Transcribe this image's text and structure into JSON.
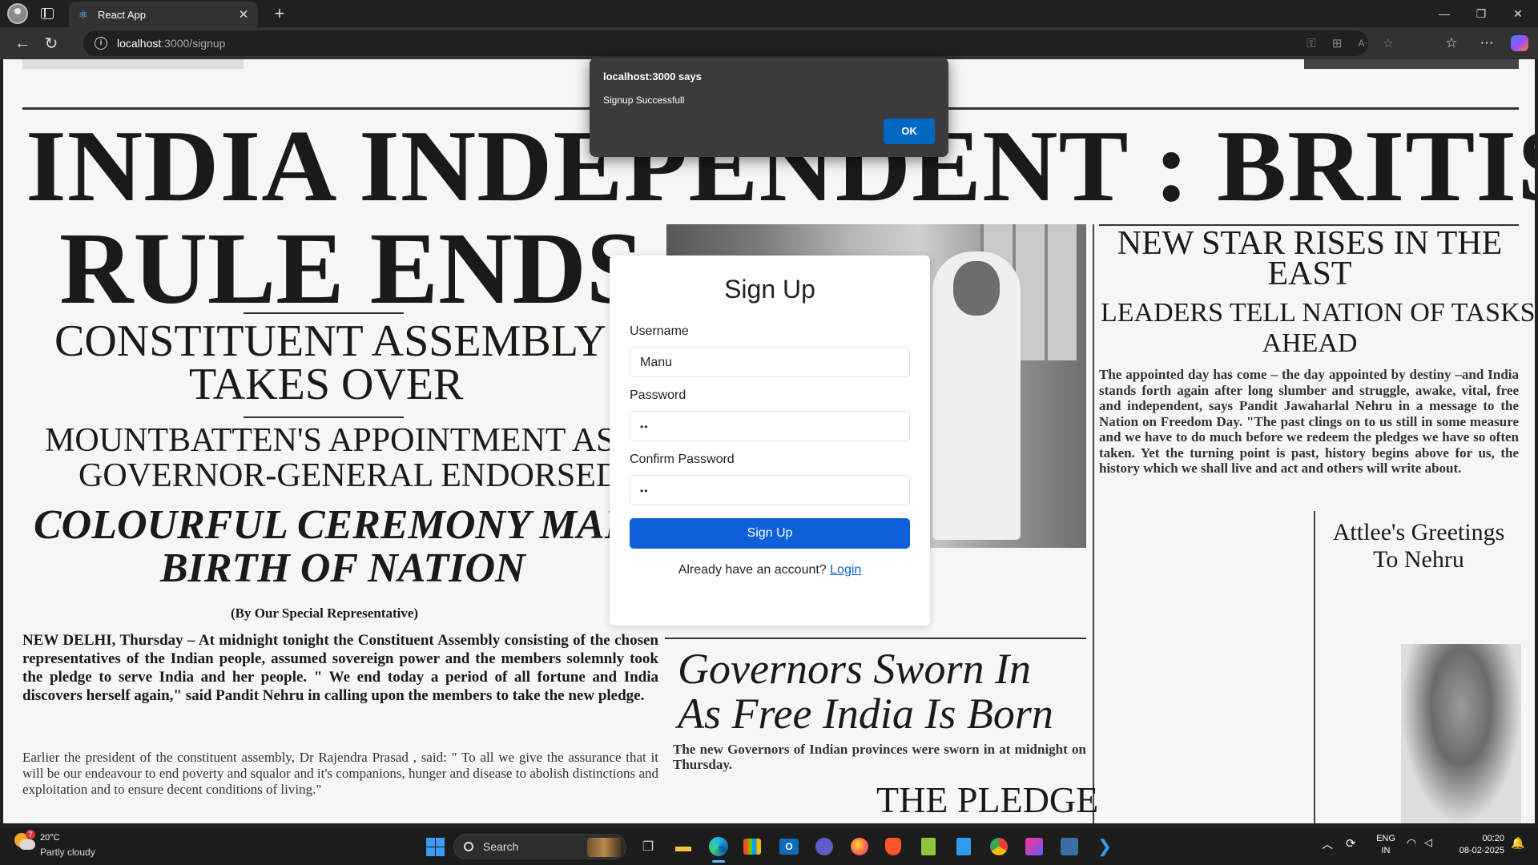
{
  "browser": {
    "tab_title": "React App",
    "tab_icon": "react-icon",
    "url_host": "localhost",
    "url_path": ":3000/signup",
    "icons": [
      "back-icon",
      "refresh-icon",
      "info-icon",
      "key-icon",
      "apps-icon",
      "read-aloud-icon",
      "favorite-icon",
      "favorites-icon",
      "more-icon",
      "copilot-icon"
    ]
  },
  "newspaper": {
    "headline_1": "INDIA  INDEPENDENT : BRITISH",
    "headline_2": "RULE  ENDS",
    "sub_1a": "CONSTITUENT ASSEMBLY",
    "sub_1b": "TAKES OVER",
    "sub_2a": "MOUNTBATTEN'S  APPOINTMENT  AS",
    "sub_2b": "GOVERNOR-GENERAL  ENDORSED",
    "sub_3a": "COLOURFUL CEREMONY MARKS",
    "sub_3b": "BIRTH OF NATION",
    "byline": "(By Our Special Representative)",
    "lead": "NEW DELHI, Thursday – At midnight tonight the Constituent Assembly consisting of the chosen representatives of the Indian people, assumed sovereign power and the members solemnly took the pledge to serve India and her people. \" We end today a period of all fortune and India discovers herself again,\" said Pandit Nehru in calling upon the members to take the new pledge.",
    "lead_2": "Earlier the president of the constituent assembly, Dr Rajendra Prasad , said: \" To all we give the assurance that it will be our endeavour to end poverty and squalor and it's companions, hunger and disease to abolish distinctions and exploitation and to ensure decent conditions of living.\"",
    "right_h1a": "NEW STAR RISES IN THE",
    "right_h1b": "EAST",
    "right_h2a": "LEADERS TELL NATION OF TASKS",
    "right_h2b": "AHEAD",
    "right_body": "The appointed day has come – the day appointed by destiny –and India stands forth again after long slumber and struggle, awake, vital, free and independent, says Pandit Jawaharlal Nehru in a message to the Nation on Freedom Day. \"The past clings on to us still in some measure and we have to do much before we redeem the pledges we have so often taken. Yet the turning point is past, history begins above for us, the history which we shall live and act and others will write about.",
    "attlee_a": "Attlee's Greetings",
    "attlee_b": "To Nehru",
    "governors_a": "Governors Sworn In",
    "governors_b": "As Free India Is Born",
    "governors_body": "The new Governors of Indian provinces were sworn in at midnight on Thursday.",
    "pledge": "THE PLEDGE"
  },
  "signup": {
    "title": "Sign Up",
    "username_label": "Username",
    "username_value": "Manu",
    "password_label": "Password",
    "password_value": "••",
    "confirm_label": "Confirm Password",
    "confirm_value": "••",
    "submit_label": "Sign Up",
    "login_prompt": "Already have an account?",
    "login_link": "Login"
  },
  "alert": {
    "title": "localhost:3000 says",
    "message": "Signup Successfull",
    "ok_label": "OK"
  },
  "taskbar": {
    "temperature": "20°C",
    "condition": "Partly cloudy",
    "weather_badge": "7",
    "search_placeholder": "Search",
    "lang_1": "ENG",
    "lang_2": "IN",
    "time": "00:20",
    "date": "08-02-2025",
    "apps": [
      "windows-start-icon",
      "search-icon",
      "task-view-icon",
      "file-explorer-icon",
      "edge-icon",
      "microsoft-store-icon",
      "outlook-icon",
      "app-icon",
      "firefox-icon",
      "brave-icon",
      "notepad-plus-icon",
      "notepad-icon",
      "chrome-icon",
      "jetbrains-icon",
      "app-icon-2",
      "vscode-icon"
    ]
  }
}
